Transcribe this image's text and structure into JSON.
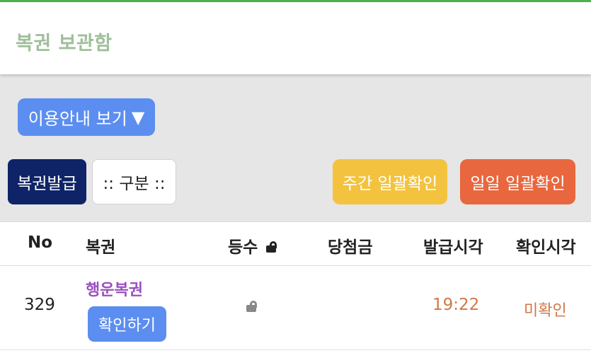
{
  "colors": {
    "accent_green": "#4caf50",
    "title_green": "#9fbf9a",
    "guide_blue": "#5b8ef0",
    "navy": "#0f2466",
    "weekly_yellow": "#f3c33f",
    "daily_orange": "#e8673e",
    "lottery_purple": "#9a4fbf",
    "time_orange": "#d0784a"
  },
  "header": {
    "title": "복권 보관함"
  },
  "guide": {
    "label": "이용안내 보기",
    "arrow": "▼"
  },
  "actions": {
    "issue": "복권발급",
    "category": ":: 구분 ::",
    "weekly_confirm": "주간 일괄확인",
    "daily_confirm": "일일 일괄확인"
  },
  "table": {
    "columns": {
      "no": "No",
      "lottery": "복권",
      "rank": "등수",
      "prize": "당첨금",
      "issued_time": "발급시각",
      "confirmed_time": "확인시각"
    },
    "rows": [
      {
        "no": "329",
        "lottery_name": "행운복권",
        "confirm_label": "확인하기",
        "rank_icon": "unlock-icon",
        "prize": "",
        "issued_time": "19:22",
        "confirmed_time": "미확인"
      }
    ]
  }
}
